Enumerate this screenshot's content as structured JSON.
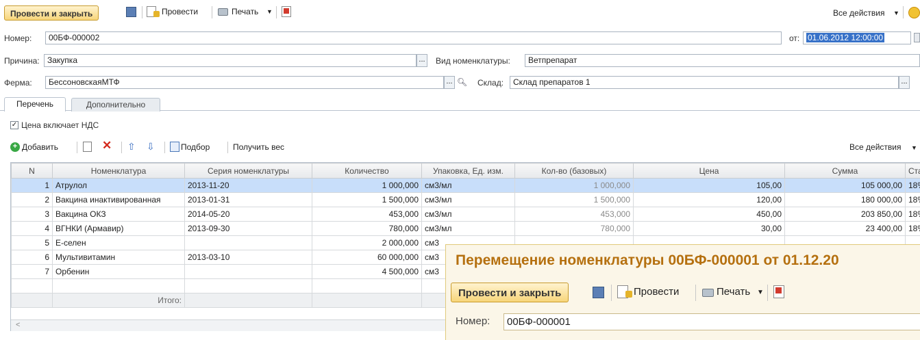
{
  "toolbar": {
    "post_close": "Провести и закрыть",
    "post": "Провести",
    "print": "Печать",
    "all_actions": "Все действия"
  },
  "header": {
    "number_label": "Номер:",
    "number_value": "00БФ-000002",
    "date_label": "от:",
    "date_value": "01.06.2012 12:00:00",
    "reason_label": "Причина:",
    "reason_value": "Закупка",
    "nom_kind_label": "Вид номенклатуры:",
    "nom_kind_value": "Ветпрепарат",
    "farm_label": "Ферма:",
    "farm_value": "БессоновскаяМТФ",
    "warehouse_label": "Склад:",
    "warehouse_value": "Склад препаратов 1",
    "dots": "..."
  },
  "tabs": [
    "Перечень",
    "Дополнительно"
  ],
  "vat_checkbox_label": "Цена включает НДС",
  "table_toolbar": {
    "add": "Добавить",
    "select": "Подбор",
    "get_weight": "Получить вес",
    "all_actions": "Все действия"
  },
  "table": {
    "columns": [
      "N",
      "Номенклатура",
      "Серия номенклатуры",
      "Количество",
      "Упаковка, Ед. изм.",
      "Кол-во (базовых)",
      "Цена",
      "Сумма",
      "Став"
    ],
    "rows": [
      {
        "n": "1",
        "name": "Атрулол",
        "series": "2013-11-20",
        "qty": "1 000,000",
        "unit": "см3/мл",
        "base": "1 000,000",
        "price": "105,00",
        "sum": "105 000,00",
        "rate": "18%"
      },
      {
        "n": "2",
        "name": "Вакцина инактивированная",
        "series": "2013-01-31",
        "qty": "1 500,000",
        "unit": "см3/мл",
        "base": "1 500,000",
        "price": "120,00",
        "sum": "180 000,00",
        "rate": "18%"
      },
      {
        "n": "3",
        "name": "Вакцина ОКЗ",
        "series": "2014-05-20",
        "qty": "453,000",
        "unit": "см3/мл",
        "base": "453,000",
        "price": "450,00",
        "sum": "203 850,00",
        "rate": "18%"
      },
      {
        "n": "4",
        "name": "ВГНКИ (Армавир)",
        "series": "2013-09-30",
        "qty": "780,000",
        "unit": "см3/мл",
        "base": "780,000",
        "price": "30,00",
        "sum": "23 400,00",
        "rate": "18%"
      },
      {
        "n": "5",
        "name": "Е-селен",
        "series": "",
        "qty": "2 000,000",
        "unit": "см3",
        "base": "",
        "price": "",
        "sum": "",
        "rate": ""
      },
      {
        "n": "6",
        "name": "Мультивитамин",
        "series": "2013-03-10",
        "qty": "60 000,000",
        "unit": "см3",
        "base": "",
        "price": "",
        "sum": "",
        "rate": ""
      },
      {
        "n": "7",
        "name": "Орбенин",
        "series": "",
        "qty": "4 500,000",
        "unit": "см3",
        "base": "",
        "price": "",
        "sum": "",
        "rate": ""
      }
    ],
    "total_label": "Итого:"
  },
  "popup": {
    "title": "Перемещение номенклатуры 00БФ-000001 от 01.12.20",
    "post_close": "Провести и закрыть",
    "post": "Провести",
    "print": "Печать",
    "number_label": "Номер:",
    "number_value": "00БФ-000001"
  }
}
